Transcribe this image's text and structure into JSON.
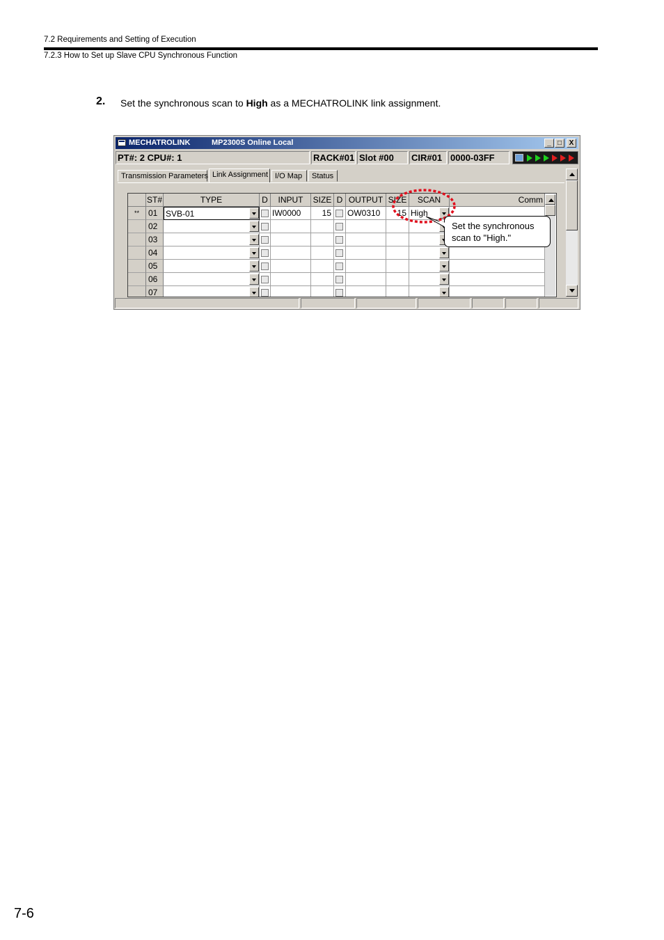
{
  "header": {
    "section": "7.2  Requirements and Setting of Execution",
    "subsection": "7.2.3  How to Set up Slave CPU Synchronous Function"
  },
  "step": {
    "number": "2.",
    "text_before": "Set the synchronous scan to ",
    "text_bold": "High",
    "text_after": " as a MECHATROLINK link assignment."
  },
  "window": {
    "title": "MECHATROLINK",
    "subtitle": "MP2300S  Online  Local",
    "controls": {
      "minimize": "_",
      "maximize": "□",
      "close": "X"
    },
    "info": {
      "pt_cpu": "PT#: 2 CPU#: 1",
      "rack": "RACK#01",
      "slot": "Slot #00",
      "cir": "CIR#01",
      "range": "0000-03FF"
    },
    "tabs": [
      "Transmission Parameters",
      "Link Assignment",
      "I/O Map",
      "Status"
    ],
    "active_tab": "Link Assignment",
    "columns": {
      "st": "ST#",
      "type": "TYPE",
      "d1": "D",
      "input": "INPUT",
      "size1": "SIZE",
      "d2": "D",
      "output": "OUTPUT",
      "size2": "SIZE",
      "scan": "SCAN",
      "comment": "Comm"
    },
    "rows": [
      {
        "marker": "**",
        "st": "01",
        "type": "SVB-01",
        "input": "IW0000",
        "input_size": "15",
        "output": "OW0310",
        "output_size": "15",
        "scan": "High"
      },
      {
        "marker": "",
        "st": "02",
        "type": "",
        "input": "",
        "input_size": "",
        "output": "",
        "output_size": "",
        "scan": ""
      },
      {
        "marker": "",
        "st": "03",
        "type": "",
        "input": "",
        "input_size": "",
        "output": "",
        "output_size": "",
        "scan": ""
      },
      {
        "marker": "",
        "st": "04",
        "type": "",
        "input": "",
        "input_size": "",
        "output": "",
        "output_size": "",
        "scan": ""
      },
      {
        "marker": "",
        "st": "05",
        "type": "",
        "input": "",
        "input_size": "",
        "output": "",
        "output_size": "",
        "scan": ""
      },
      {
        "marker": "",
        "st": "06",
        "type": "",
        "input": "",
        "input_size": "",
        "output": "",
        "output_size": "",
        "scan": ""
      },
      {
        "marker": "",
        "st": "07",
        "type": "",
        "input": "",
        "input_size": "",
        "output": "",
        "output_size": "",
        "scan": ""
      }
    ]
  },
  "callout": {
    "line1": "Set the synchronous",
    "line2": "scan to \"High.\""
  },
  "page_number": "7-6",
  "colors": {
    "highlight_circle": "#e0101e",
    "title_bar": "#0a246a",
    "arrow_green": "#1fd01f",
    "arrow_red": "#e02020"
  }
}
